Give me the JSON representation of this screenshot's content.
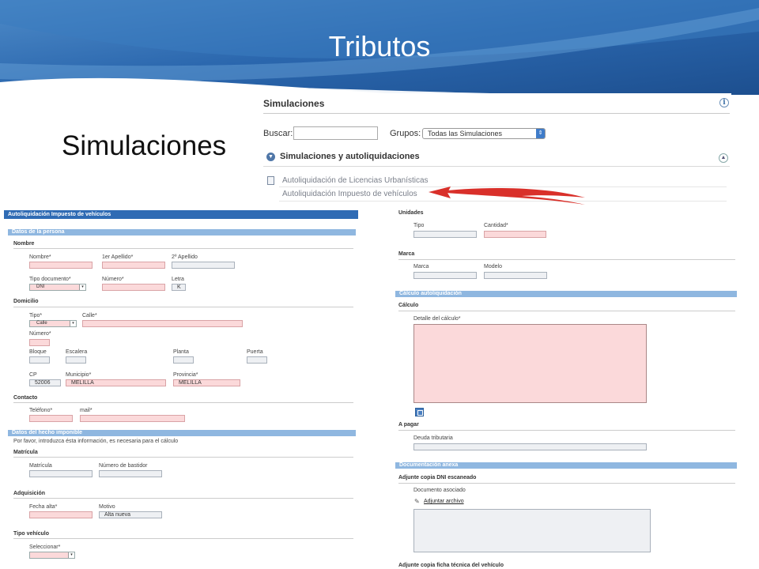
{
  "slide": {
    "title": "Tributos",
    "subtitle": "Simulaciones"
  },
  "colors": {
    "banner": "#2c6cb0",
    "section_bar": "#8fb7e0",
    "header_bar": "#2f6bb4",
    "required_field": "#fbd9da",
    "arrow": "#d9302a"
  },
  "simulations_panel": {
    "header": "Simulaciones",
    "info_icon": "info-icon",
    "search_label": "Buscar:",
    "search_value": "",
    "groups_label": "Grupos:",
    "groups_selected": "Todas las Simulaciones",
    "section_title": "Simulaciones y autoliquidaciones",
    "items": [
      "Autoliquidación de Licencias Urbanísticas",
      "Autoliquidación Impuesto de vehículos"
    ]
  },
  "left_form": {
    "header": "Autoliquidación Impuesto de vehículos",
    "persona_bar": "Datos de la persona",
    "nombre_group": "Nombre",
    "nombre_label": "Nombre*",
    "apellido1_label": "1er Apellido*",
    "apellido2_label": "2º Apellido",
    "tipo_doc_label": "Tipo documento*",
    "tipo_doc_value": "DNI",
    "numero_doc_label": "Número*",
    "letra_label": "Letra",
    "letra_value": "K",
    "domicilio_group": "Domicilio",
    "tipo_via_label": "Tipo*",
    "tipo_via_value": "Calle",
    "calle_label": "Calle*",
    "numero_label": "Número*",
    "bloque_label": "Bloque",
    "escalera_label": "Escalera",
    "planta_label": "Planta",
    "puerta_label": "Puerta",
    "cp_label": "CP",
    "cp_value": "52006",
    "municipio_label": "Municipio*",
    "municipio_value": "MELILLA",
    "provincia_label": "Provincia*",
    "provincia_value": "MELILLA",
    "contacto_group": "Contacto",
    "telefono_label": "Teléfono*",
    "mail_label": "mail*",
    "hecho_bar": "Datos del hecho imponible",
    "hecho_note": "Por favor, introduzca ésta información, es necesaria para el cálculo",
    "matricula_group": "Matrícula",
    "matricula_label": "Matrícula",
    "bastidor_label": "Número de bastidor",
    "adquisicion_group": "Adquisición",
    "fecha_alta_label": "Fecha alta*",
    "motivo_label": "Motivo",
    "motivo_value": "Alta nueva",
    "tipo_vehiculo_group": "Tipo vehículo",
    "seleccionar_label": "Seleccionar*"
  },
  "right_form": {
    "unidades_group": "Unidades",
    "tipo_label": "Tipo",
    "cantidad_label": "Cantidad*",
    "marca_group": "Marca",
    "marca_label": "Marca",
    "modelo_label": "Modelo",
    "calculo_bar": "Cálculo autoliquidación",
    "calculo_group": "Cálculo",
    "detalle_label": "Detalle del cálculo*",
    "pagar_group": "A pagar",
    "deuda_label": "Deuda tributaria",
    "doc_bar": "Documentación anexa",
    "dni_group": "Adjunte copia DNI escaneado",
    "doc_asociado_label": "Documento asociado",
    "adjuntar_link": "Adjuntar archivo",
    "ficha_group": "Adjunte copia ficha técnica del vehículo"
  }
}
